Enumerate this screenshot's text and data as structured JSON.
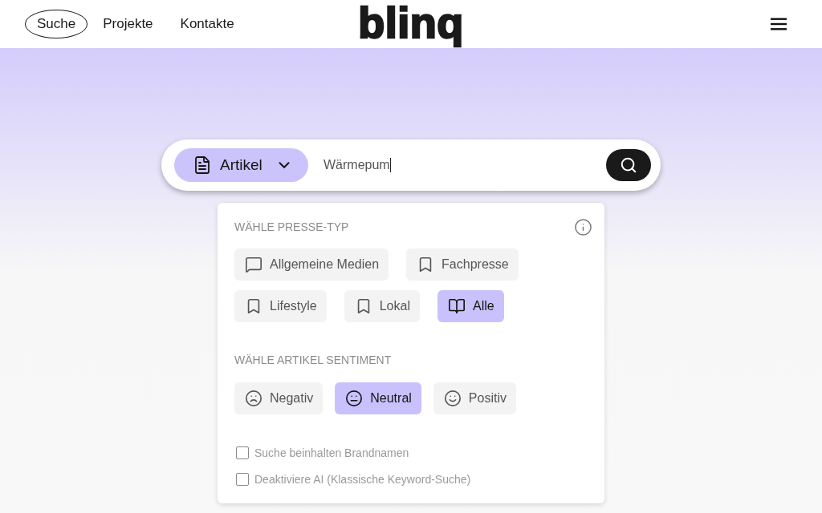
{
  "nav": {
    "links": [
      {
        "label": "Suche",
        "selected": true
      },
      {
        "label": "Projekte",
        "selected": false
      },
      {
        "label": "Kontakte",
        "selected": false
      }
    ],
    "logo": "blinq"
  },
  "search": {
    "type_selector": "Artikel",
    "value": "Wärmepum"
  },
  "filters": {
    "press_type": {
      "heading": "WÄHLE PRESSE-TYP",
      "options": [
        {
          "label": "Allgemeine Medien",
          "kind": "speech",
          "selected": false
        },
        {
          "label": "Fachpresse",
          "kind": "bookmark",
          "selected": false
        },
        {
          "label": "Lifestyle",
          "kind": "bookmark",
          "selected": false
        },
        {
          "label": "Lokal",
          "kind": "bookmark",
          "selected": false
        },
        {
          "label": "Alle",
          "kind": "book",
          "selected": true
        }
      ]
    },
    "sentiment": {
      "heading": "WÄHLE ARTIKEL SENTIMENT",
      "options": [
        {
          "label": "Negativ",
          "kind": "negative",
          "selected": false
        },
        {
          "label": "Neutral",
          "kind": "neutral",
          "selected": true
        },
        {
          "label": "Positiv",
          "kind": "positive",
          "selected": false
        }
      ]
    },
    "checkboxes": [
      {
        "label": "Suche beinhalten Brandnamen",
        "checked": false
      },
      {
        "label": "Deaktiviere AI (Klassische Keyword-Suche)",
        "checked": false
      }
    ]
  }
}
